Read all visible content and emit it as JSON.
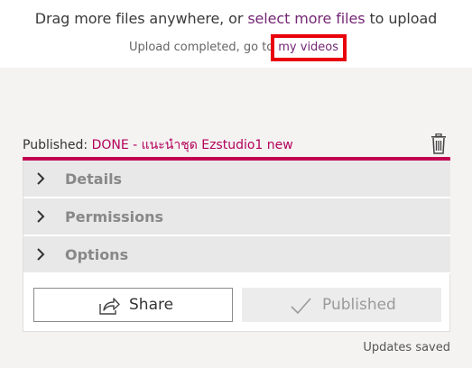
{
  "upload": {
    "drag_prefix": "Drag more files anywhere, or ",
    "select_more_files": "select more files",
    "drag_suffix": " to upload",
    "status_prefix": "Upload completed, go to",
    "my_videos": "my videos"
  },
  "video": {
    "published_label": "Published: ",
    "title": "DONE - แนะนำชุด Ezstudio1 new"
  },
  "sections": [
    {
      "label": "Details",
      "icon": "chevron-right-icon"
    },
    {
      "label": "Permissions",
      "icon": "chevron-right-icon"
    },
    {
      "label": "Options",
      "icon": "chevron-right-icon"
    }
  ],
  "buttons": {
    "share": "Share",
    "published": "Published"
  },
  "footer": {
    "status": "Updates saved"
  },
  "colors": {
    "accent": "#c30052",
    "link": "#742774",
    "highlight": "#e8000b"
  }
}
